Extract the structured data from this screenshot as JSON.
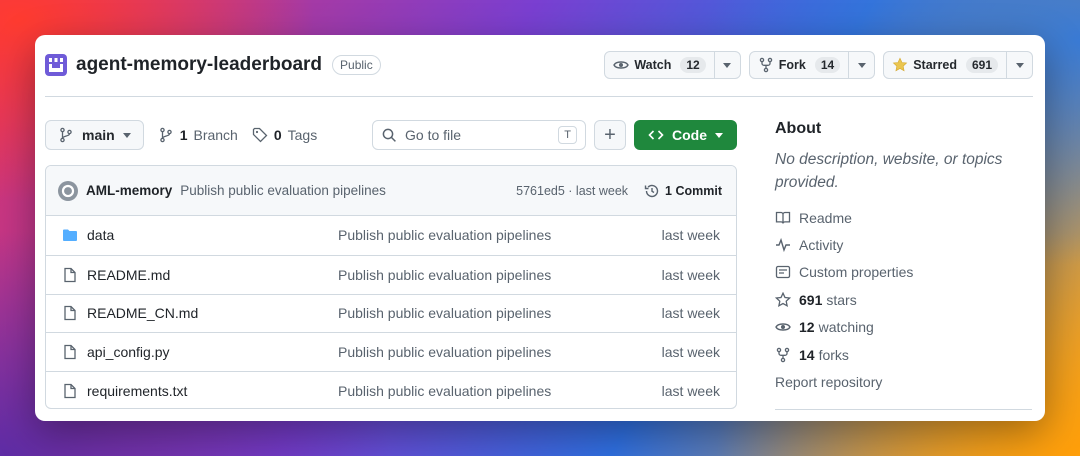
{
  "repo": {
    "name": "agent-memory-leaderboard",
    "visibility": "Public"
  },
  "actions": {
    "watch_label": "Watch",
    "watch_count": "12",
    "fork_label": "Fork",
    "fork_count": "14",
    "star_label": "Starred",
    "star_count": "691"
  },
  "toolbar": {
    "branch": "main",
    "branch_count": "1",
    "branch_word": "Branch",
    "tag_count": "0",
    "tag_word": "Tags",
    "goto_placeholder": "Go to file",
    "goto_shortcut": "T",
    "add_label": "+",
    "code_label": "Code"
  },
  "commit": {
    "author": "AML-memory",
    "message": "Publish public evaluation pipelines",
    "meta": "5761ed5 · last week",
    "commits_label": "1 Commit"
  },
  "files": [
    {
      "type": "folder",
      "name": "data",
      "message": "Publish public evaluation pipelines",
      "date": "last week"
    },
    {
      "type": "file",
      "name": "README.md",
      "message": "Publish public evaluation pipelines",
      "date": "last week"
    },
    {
      "type": "file",
      "name": "README_CN.md",
      "message": "Publish public evaluation pipelines",
      "date": "last week"
    },
    {
      "type": "file",
      "name": "api_config.py",
      "message": "Publish public evaluation pipelines",
      "date": "last week"
    },
    {
      "type": "file",
      "name": "requirements.txt",
      "message": "Publish public evaluation pipelines",
      "date": "last week"
    }
  ],
  "about": {
    "title": "About",
    "description": "No description, website, or topics provided.",
    "readme": "Readme",
    "activity": "Activity",
    "custom_properties": "Custom properties",
    "stars_count": "691",
    "stars_word": "stars",
    "watching_count": "12",
    "watching_word": "watching",
    "forks_count": "14",
    "forks_word": "forks",
    "report": "Report repository"
  },
  "colors": {
    "accent_green": "#1f883d",
    "folder_blue": "#54aeff",
    "star_yellow": "#eac54f",
    "logo_purple": "#6f5bd8"
  }
}
